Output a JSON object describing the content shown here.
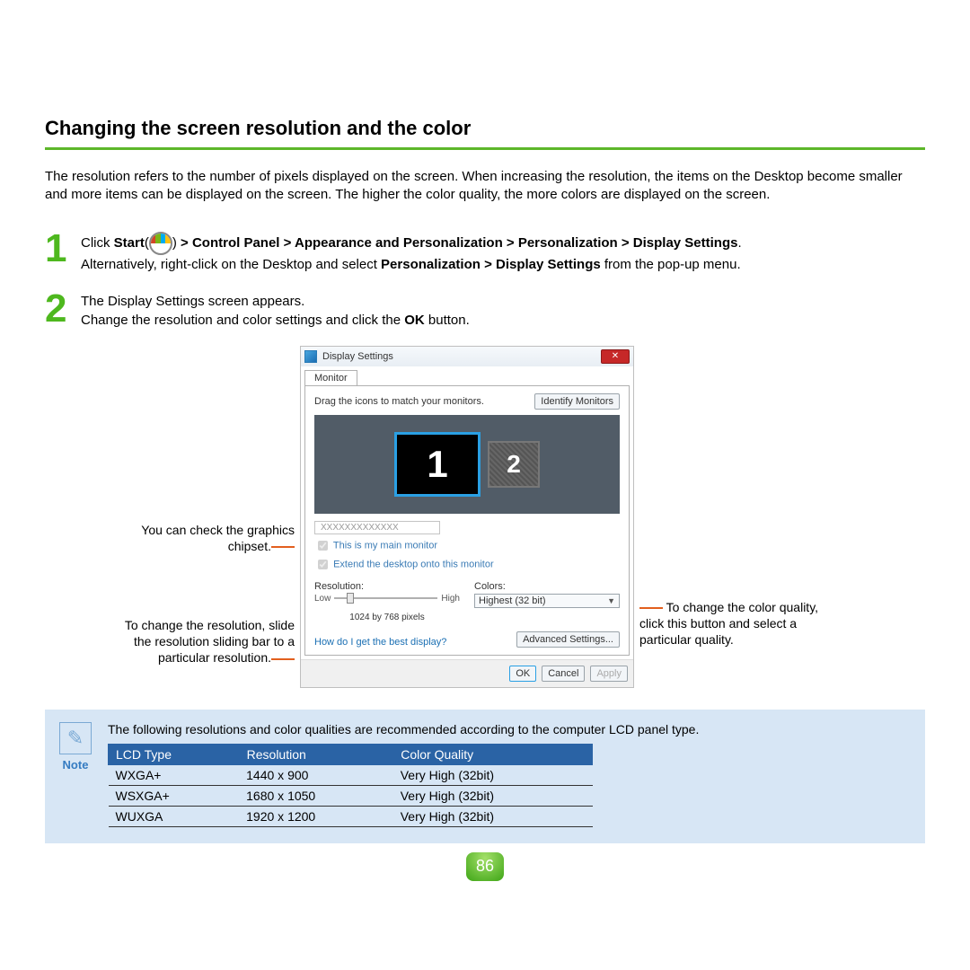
{
  "title": "Changing the screen resolution and the color",
  "intro": "The resolution refers to the number of pixels displayed on the screen. When increasing the resolution, the items on the Desktop become smaller and more items can be displayed on the screen. The higher the color quality, the more colors are displayed on the screen.",
  "steps": {
    "s1": {
      "num": "1",
      "pre": "Click ",
      "start": "Start",
      "path": " > Control Panel > Appearance and Personalization > Personalization > Display Settings",
      "alt_pre": "Alternatively, right-click on the Desktop and select ",
      "alt_bold": "Personalization > Display Settings",
      "alt_post": " from the pop-up menu."
    },
    "s2": {
      "num": "2",
      "l1": "The Display Settings screen appears.",
      "l2_pre": "Change the resolution and color settings and click the ",
      "l2_bold": "OK",
      "l2_post": " button."
    }
  },
  "callouts": {
    "chip": "You can check the graphics chipset.",
    "res": "To change the resolution, slide the resolution sliding bar to a particular resolution.",
    "color": "To change the color quality, click this button and select a particular quality."
  },
  "dialog": {
    "title": "Display Settings",
    "tab": "Monitor",
    "drag": "Drag the icons to match your monitors.",
    "identify": "Identify Monitors",
    "mon1": "1",
    "mon2": "2",
    "chipset": "XXXXXXXXXXXXX",
    "chk_main": "This is my main monitor",
    "chk_ext": "Extend the desktop onto this monitor",
    "res_label": "Resolution:",
    "low": "Low",
    "high": "High",
    "cur_res": "1024 by 768 pixels",
    "col_label": "Colors:",
    "col_value": "Highest (32 bit)",
    "help_link": "How do I get the best display?",
    "adv": "Advanced Settings...",
    "ok": "OK",
    "cancel": "Cancel",
    "apply": "Apply"
  },
  "note": {
    "label": "Note",
    "text": "The following resolutions and color qualities are recommended according to the computer LCD panel type.",
    "headers": {
      "type": "LCD Type",
      "res": "Resolution",
      "col": "Color Quality"
    },
    "rows": [
      {
        "type": "WXGA+",
        "res": "1440 x 900",
        "col": "Very High (32bit)"
      },
      {
        "type": "WSXGA+",
        "res": "1680 x 1050",
        "col": "Very High (32bit)"
      },
      {
        "type": "WUXGA",
        "res": "1920 x 1200",
        "col": "Very High (32bit)"
      }
    ]
  },
  "page_number": "86"
}
